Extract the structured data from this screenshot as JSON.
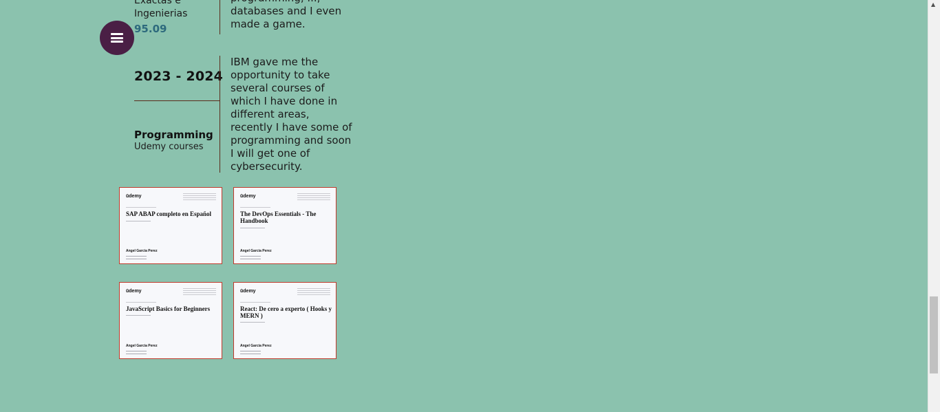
{
  "education": {
    "institution_partial": "Exactas e\nIngenierias",
    "score": "95.09",
    "description_partial": "programming, ...,\ndatabases and I even\nmade a game."
  },
  "entry": {
    "years": "2023 - 2024",
    "title": "Programming",
    "subtitle": "Udemy courses",
    "description": "IBM gave me the opportunity to take several courses of which I have done in different areas, recently I have some of programming and soon I will get one of cybersecurity."
  },
  "certificates": [
    {
      "logo": "ūdemy",
      "title": "SAP ABAP completo en Español",
      "name": "Angel Garcia Perez"
    },
    {
      "logo": "ūdemy",
      "title": "The DevOps Essentials - The Handbook",
      "name": "Angel Garcia Perez"
    },
    {
      "logo": "ūdemy",
      "title": "JavaScript Basics for Beginners",
      "name": "Angel Garcia Perez"
    },
    {
      "logo": "ūdemy",
      "title": "React: De cero a experto ( Hooks y MERN )",
      "name": "Angel Garcia Perez"
    }
  ],
  "menu": {
    "icon": "hamburger-menu-icon"
  },
  "colors": {
    "background": "#8bc2ae",
    "menu_button": "#4a1f45",
    "score": "#2d6a7d",
    "divider": "#5a2a1a",
    "certificate_border": "#c0392b"
  }
}
